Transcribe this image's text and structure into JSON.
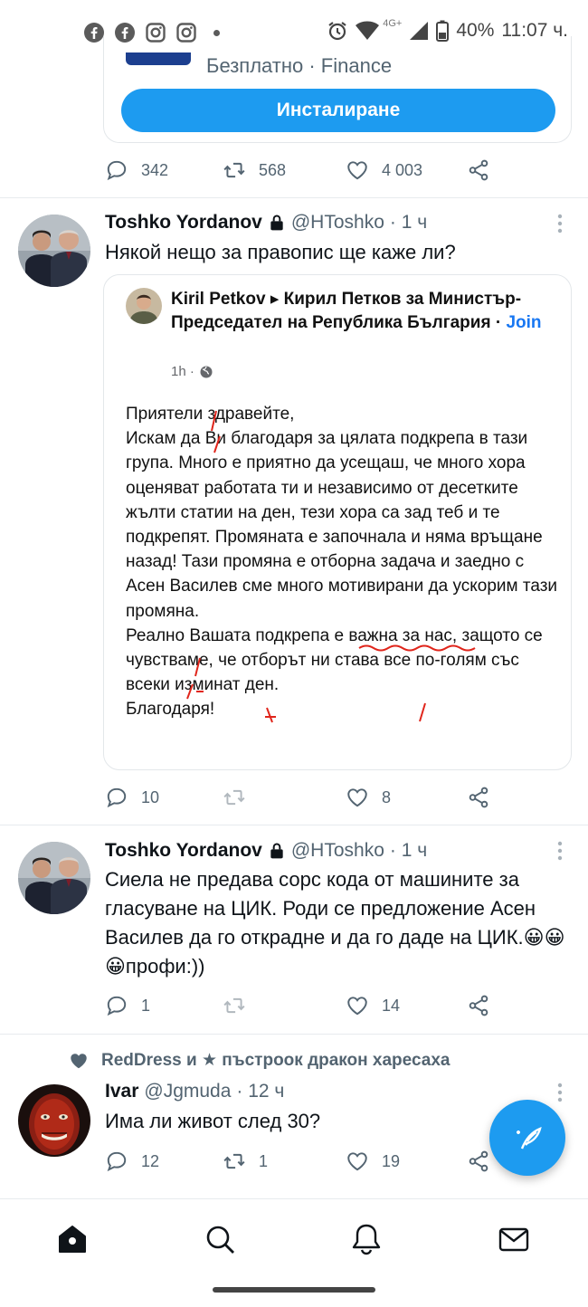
{
  "status_bar": {
    "network": "4G+",
    "battery": "40%",
    "time": "11:07 ч.",
    "notification_icons": [
      "facebook-icon",
      "facebook-icon",
      "instagram-icon",
      "instagram-icon"
    ]
  },
  "ad": {
    "subtitle": "Безплатно · Finance",
    "install_label": "Инсталиране",
    "reply_count": "342",
    "retweet_count": "568",
    "like_count": "4 003"
  },
  "tweets": [
    {
      "name": "Toshko Yordanov",
      "handle": "@HToshko",
      "time": "· 1 ч",
      "text": "Някой нещо за правопис ще каже ли?",
      "embed": {
        "author": "Kiril Petkov",
        "group": "Кирил Петков за Министър-Председател на Република България",
        "join": "Join",
        "time": "1h ·",
        "body": "Приятели здравейте,\nИскам да Ви благодаря за цялата подкрепа в тази група.  Много е приятно да усещаш, че много хора оценяват работата ти и независимо от десетките жълти статии на ден, тези хора са зад теб и те подкрепят. Промяната е започнала и няма връщане назад!  Тази промяна е отборна задача и заедно с Асен Василев сме много мотивирани да ускорим тази промяна.\nРеално Вашата подкрепа е важна за нас, защото се чувстваме, че отборът ни става все по-голям със всеки изминат ден.\nБлагодаря!"
      },
      "reply_count": "10",
      "retweet_count": "",
      "like_count": "8"
    },
    {
      "name": "Toshko Yordanov",
      "handle": "@HToshko",
      "time": "· 1 ч",
      "text": "Сиела не предава сорс кода от машините за гласуване на ЦИК. Роди се предложение Асен Василев да го открадне и да го даде на ЦИК.😀😀😀профи:))",
      "reply_count": "1",
      "retweet_count": "",
      "like_count": "14"
    },
    {
      "liked_by": "RedDress и ★ пъстроок дракон харесаха",
      "name": "Ivar",
      "handle": "@Jgmuda",
      "time": "· 12 ч",
      "text": "Има ли живот след 30?",
      "reply_count": "12",
      "retweet_count": "1",
      "like_count": "19"
    }
  ],
  "colors": {
    "accent": "#1d9bf0",
    "text": "#0f1419",
    "muted": "#536471",
    "fb_link": "#1877f2",
    "red_marks": "#e0251b"
  },
  "nav": [
    "home-icon",
    "search-icon",
    "notifications-icon",
    "messages-icon"
  ]
}
